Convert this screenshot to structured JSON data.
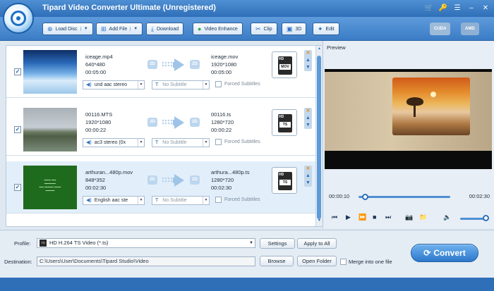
{
  "window": {
    "title": "Tipard Video Converter Ultimate (Unregistered)",
    "controls": {
      "cart": "🛒",
      "key": "🔑",
      "menu": "☰",
      "minimize": "–",
      "close": "✕"
    }
  },
  "toolbar": {
    "load_disc": "Load Disc",
    "add_file": "Add File",
    "download": "Download",
    "video_enhance": "Video Enhance",
    "clip": "Clip",
    "threed": "3D",
    "edit": "Edit",
    "cuda": "CUDA",
    "amd": "AMD"
  },
  "files": [
    {
      "name": "iceage.mp4",
      "resolution": "640*480",
      "duration": "00:05:00",
      "out_name": "iceage.mov",
      "out_resolution": "1920*1080",
      "out_duration": "00:05:00",
      "format": "MOV",
      "audio": "und aac stereo",
      "subtitle": "No Subtitle",
      "forced": "Forced Subtitles",
      "badge": "2D"
    },
    {
      "name": "00116.MTS",
      "resolution": "1920*1080",
      "duration": "00:00:22",
      "out_name": "00116.ts",
      "out_resolution": "1280*720",
      "out_duration": "00:00:22",
      "format": "TS",
      "audio": "ac3 stereo (0x",
      "subtitle": "No Subtitle",
      "forced": "Forced Subtitles",
      "badge": "2D"
    },
    {
      "name": "arthuran...480p.mov",
      "resolution": "848*352",
      "duration": "00:02:30",
      "out_name": "arthura...480p.ts",
      "out_resolution": "1280*720",
      "out_duration": "00:02:30",
      "format": "TS",
      "audio": "English aac ste",
      "subtitle": "No Subtitle",
      "forced": "Forced Subtitles",
      "badge": "2D"
    }
  ],
  "preview": {
    "label": "Preview",
    "time_current": "00:00:10",
    "time_total": "00:02:30",
    "progress": 0.07,
    "volume": 0.9
  },
  "bottom": {
    "profile_label": "Profile:",
    "profile_value": "HD H.264 TS Video (*.ts)",
    "settings": "Settings",
    "apply_all": "Apply to All",
    "destination_label": "Destination:",
    "destination_value": "C:\\Users\\User\\Documents\\Tipard Studio\\Video",
    "browse": "Browse",
    "open_folder": "Open Folder",
    "merge": "Merge into one file",
    "convert": "Convert"
  }
}
